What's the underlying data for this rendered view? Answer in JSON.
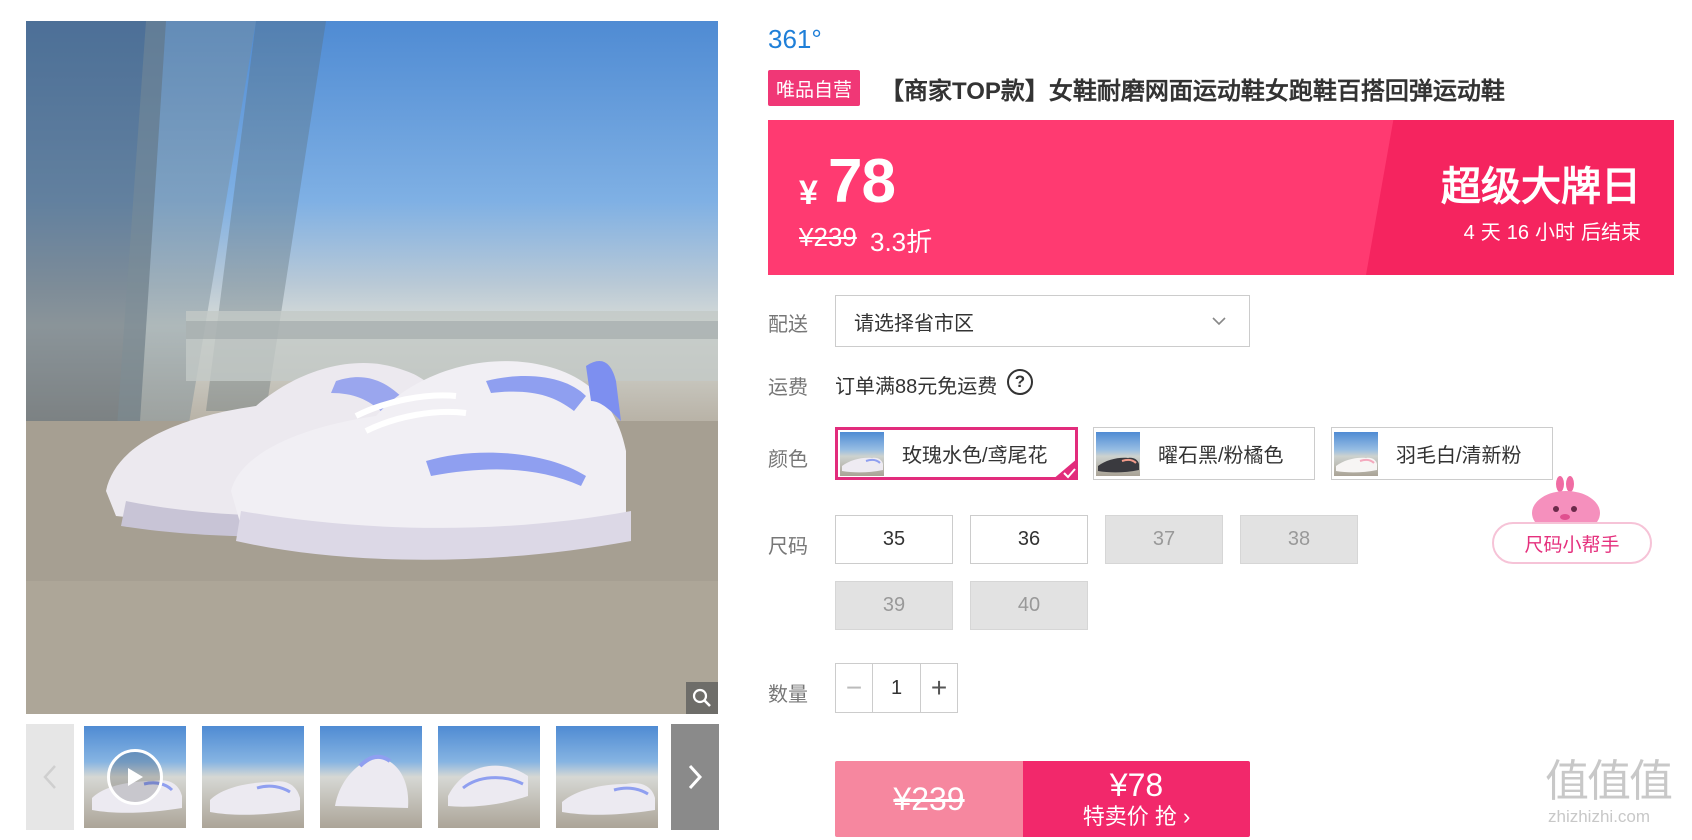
{
  "gallery": {
    "main_image": "white and periwinkle running shoes on pavement, blue sky background",
    "zoom_icon": "search-icon",
    "prev_icon": "chevron-left-icon",
    "next_icon": "chevron-right-icon",
    "play_icon": "play-icon",
    "thumbnails": [
      "video",
      "shoe-pair",
      "shoe-front",
      "shoe-sole",
      "shoe-side",
      "shoe-partial"
    ]
  },
  "product": {
    "brand": "361°",
    "badge": "唯品自营",
    "title": "【商家TOP款】女鞋耐磨网面运动鞋女跑鞋百搭回弹运动鞋"
  },
  "price": {
    "currency": "¥",
    "current": "78",
    "original": "¥239",
    "discount": "3.3折",
    "event_title": "超级大牌日",
    "countdown": {
      "days": "4",
      "days_unit": "天",
      "hours": "16",
      "hours_unit": "小时",
      "suffix": "后结束"
    }
  },
  "delivery": {
    "label": "配送",
    "placeholder": "请选择省市区",
    "dropdown_icon": "chevron-down-icon"
  },
  "shipping": {
    "label": "运费",
    "text": "订单满88元免运费",
    "help_icon": "question-icon",
    "help_glyph": "?"
  },
  "colors": {
    "label": "颜色",
    "options": [
      {
        "name": "玫瑰水色/鸢尾花",
        "selected": true
      },
      {
        "name": "曜石黑/粉橘色",
        "selected": false
      },
      {
        "name": "羽毛白/清新粉",
        "selected": false
      }
    ]
  },
  "sizes": {
    "label": "尺码",
    "options": [
      {
        "value": "35",
        "available": true
      },
      {
        "value": "36",
        "available": true
      },
      {
        "value": "37",
        "available": false
      },
      {
        "value": "38",
        "available": false
      },
      {
        "value": "39",
        "available": false
      },
      {
        "value": "40",
        "available": false
      }
    ],
    "helper": "尺码小帮手"
  },
  "quantity": {
    "label": "数量",
    "value": "1",
    "minus": "−",
    "plus": "+"
  },
  "buy_button": {
    "original": "¥239",
    "price": "¥78",
    "label": "特卖价 抢 ›"
  },
  "watermark": {
    "glyphs": "值值值",
    "url": "zhizhizhi.com"
  },
  "colors_theme": {
    "brand_blue": "#1f7fd8",
    "badge_pink": "#f03776",
    "banner_pink": "#ff3a71",
    "selected_border": "#e22c7c",
    "buy_light": "#f6879f",
    "buy_dark": "#f2286b"
  }
}
